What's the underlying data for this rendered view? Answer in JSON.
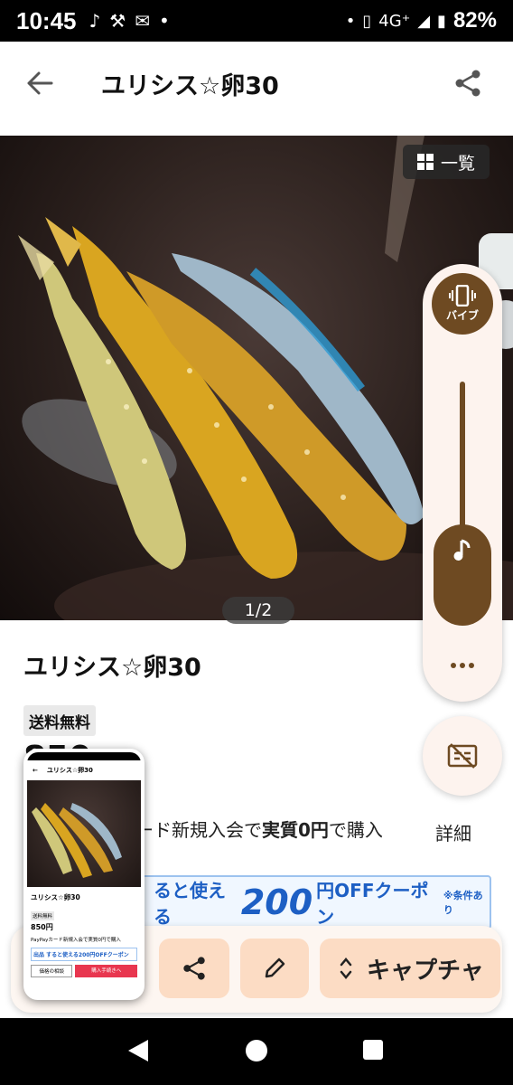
{
  "status_bar": {
    "time": "10:45",
    "network": "4G⁺",
    "battery": "82%"
  },
  "app_bar": {
    "title": "ユリシス☆卵30",
    "icons": [
      "back-arrow-icon",
      "share-icon"
    ]
  },
  "gallery": {
    "grid_button_label": "一覧",
    "page_indicator": "1/2"
  },
  "product": {
    "title": "ユリシス☆卵30",
    "shipping_badge": "送料無料",
    "price": "850",
    "promo_text_pre": "ード新規入会で",
    "promo_text_bold1": "実質0円",
    "promo_text_mid": "で購入",
    "detail_link": "詳細"
  },
  "coupon": {
    "text_a": "ると使える",
    "amount": "200",
    "text_c": "円OFFクーポン",
    "note": "※条件あり",
    "accent": "#1d5fc4"
  },
  "volume_panel": {
    "mode_label": "バイブ",
    "icons": [
      "vibrate-icon",
      "music-note-icon",
      "more-dots-icon",
      "captions-off-icon"
    ],
    "accent": "#6e4a22"
  },
  "screenshot_toolbar": {
    "capture_label": "キャプチャ",
    "icons": [
      "share-icon",
      "pencil-icon",
      "expand-icon"
    ]
  },
  "thumbnail": {
    "title": "ユリシス☆卵30",
    "badge": "送料無料",
    "price": "850円",
    "grid_label": "一覧",
    "promo": "PayPayカード新規入会で実質0円で購入",
    "detail": "詳細",
    "coupon": "出品 すると使える200円OFFクーポン",
    "btn_left": "価格の相談",
    "btn_right": "購入手続きへ"
  }
}
